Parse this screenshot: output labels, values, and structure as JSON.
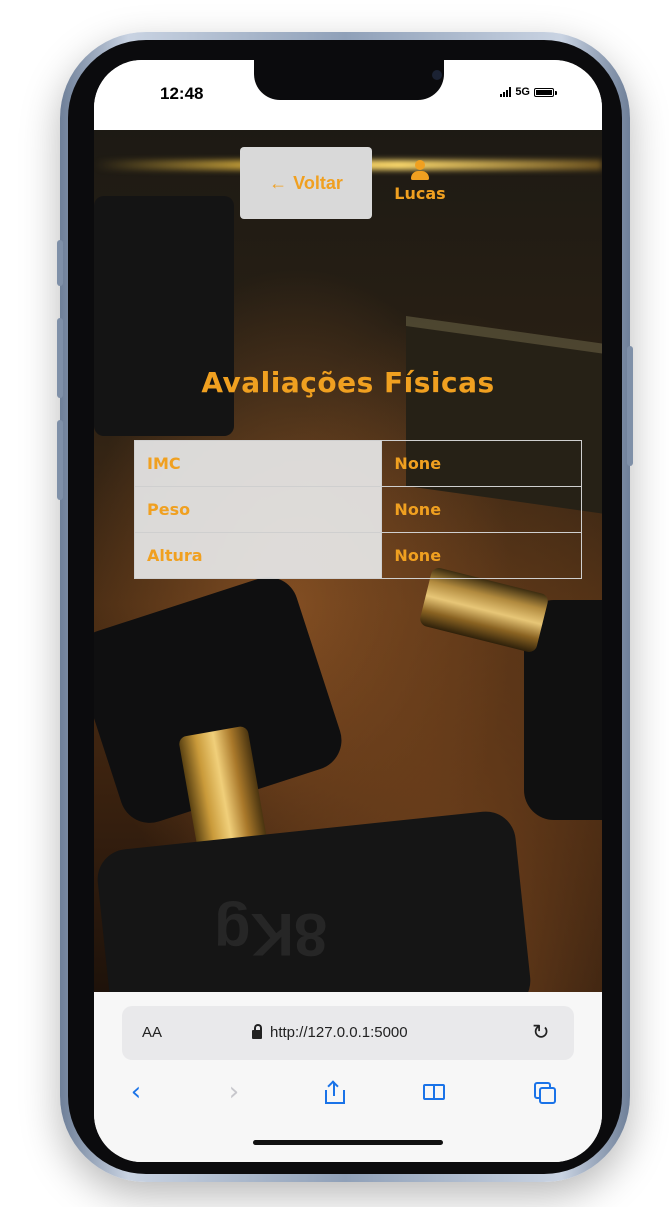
{
  "status_bar": {
    "time": "12:48",
    "network": "5G"
  },
  "header": {
    "back_label": "Voltar",
    "user_name": "Lucas"
  },
  "page": {
    "title": "Avaliações Físicas"
  },
  "metrics": [
    {
      "label": "IMC",
      "value": "None"
    },
    {
      "label": "Peso",
      "value": "None"
    },
    {
      "label": "Altura",
      "value": "None"
    }
  ],
  "browser": {
    "aa_label": "AA",
    "url": "http://127.0.0.1:5000"
  },
  "colors": {
    "accent": "#f0a020",
    "button_bg": "#d9d9d9",
    "safari_blue": "#1a73e8"
  },
  "icons": [
    "arrow-left-icon",
    "user-icon",
    "lock-icon",
    "reload-icon",
    "back-icon",
    "forward-icon",
    "share-icon",
    "bookmarks-icon",
    "tabs-icon"
  ]
}
